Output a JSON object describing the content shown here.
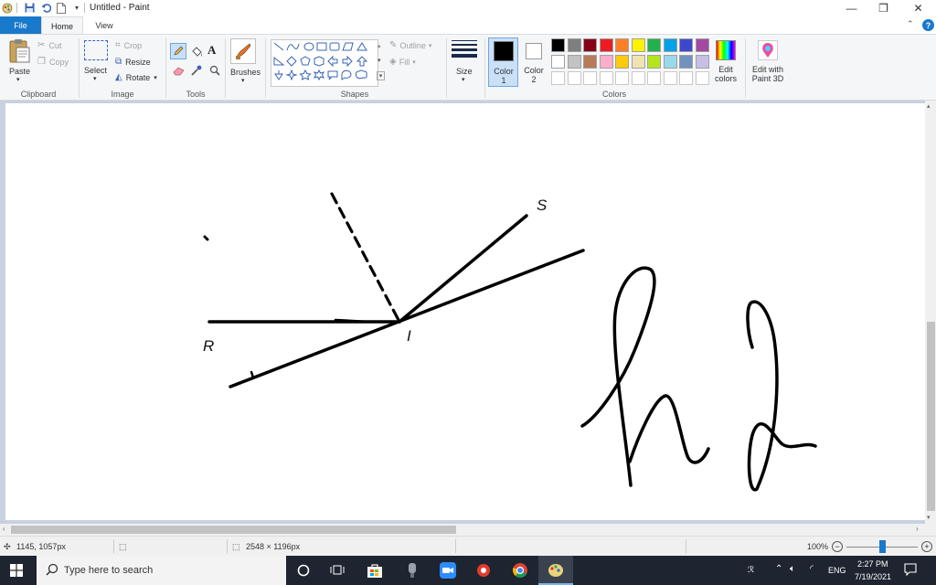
{
  "window": {
    "title": "Untitled - Paint",
    "controls": {
      "minimize": "—",
      "maximize": "❐",
      "close": "✕"
    }
  },
  "tabs": {
    "file": "File",
    "home": "Home",
    "view": "View",
    "help": "?"
  },
  "ribbon": {
    "clipboard": {
      "paste": "Paste",
      "cut": "Cut",
      "copy": "Copy",
      "label": "Clipboard"
    },
    "image": {
      "select": "Select",
      "crop": "Crop",
      "resize": "Resize",
      "rotate": "Rotate",
      "label": "Image"
    },
    "tools": {
      "label": "Tools",
      "text_tool": "A"
    },
    "brushes": {
      "label": "Brushes"
    },
    "shapes": {
      "outline": "Outline",
      "fill": "Fill",
      "label": "Shapes"
    },
    "size": {
      "label": "Size"
    },
    "colors": {
      "color1_label": "Color\n1",
      "color2_label": "Color\n2",
      "color1": "#000000",
      "color2": "#ffffff",
      "palette_row1": [
        "#000000",
        "#7f7f7f",
        "#880015",
        "#ed1c24",
        "#ff7f27",
        "#fff200",
        "#22b14c",
        "#00a2e8",
        "#3f48cc",
        "#a349a4"
      ],
      "palette_row2": [
        "#ffffff",
        "#c3c3c3",
        "#b97a57",
        "#ffaec9",
        "#ffc90e",
        "#efe4b0",
        "#b5e61d",
        "#99d9ea",
        "#7092be",
        "#c8bfe7"
      ],
      "edit_colors": "Edit\ncolors",
      "label": "Colors"
    },
    "paint3d": {
      "label": "Edit with\nPaint 3D"
    }
  },
  "canvas": {
    "labels": {
      "r": "R",
      "i": "I",
      "s": "S"
    }
  },
  "status": {
    "cursor_pos": "1145, 1057px",
    "canvas_size": "2548 × 1196px",
    "zoom": "100%",
    "zoom_level": 0.5
  },
  "taskbar": {
    "search_placeholder": "Type here to search",
    "language": "ENG",
    "time": "2:27 PM",
    "date": "7/19/2021"
  }
}
